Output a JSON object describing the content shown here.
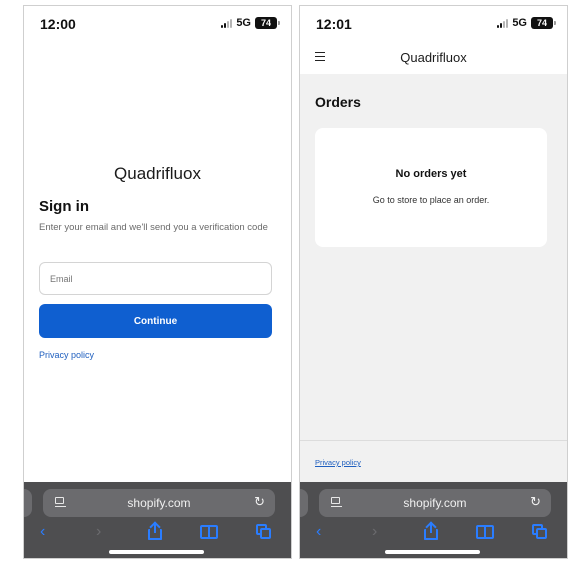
{
  "screens": {
    "left": {
      "status": {
        "time": "12:00",
        "network": "5G",
        "battery": "74"
      },
      "brand": "Quadrifluox",
      "signin": {
        "title": "Sign in",
        "description": "Enter your email and we'll send you a verification code",
        "email_placeholder": "Email",
        "continue_label": "Continue",
        "privacy_label": "Privacy policy"
      },
      "browser": {
        "url": "shopify.com"
      }
    },
    "right": {
      "status": {
        "time": "12:01",
        "network": "5G",
        "battery": "74"
      },
      "brand": "Quadrifluox",
      "orders": {
        "title": "Orders",
        "empty_title": "No orders yet",
        "empty_message": "Go to store to place an order."
      },
      "privacy_label": "Privacy policy",
      "browser": {
        "url": "shopify.com"
      }
    }
  },
  "colors": {
    "accent": "#0f5fd0",
    "link": "#1f5fbf",
    "safari_icon": "#2a7dff",
    "safari_bar": "#4e4e50"
  },
  "icons": [
    "signal-icon",
    "battery-icon",
    "menu-icon",
    "page-icon",
    "reload-icon",
    "back-icon",
    "forward-icon",
    "share-icon",
    "bookmarks-icon",
    "tabs-icon"
  ]
}
